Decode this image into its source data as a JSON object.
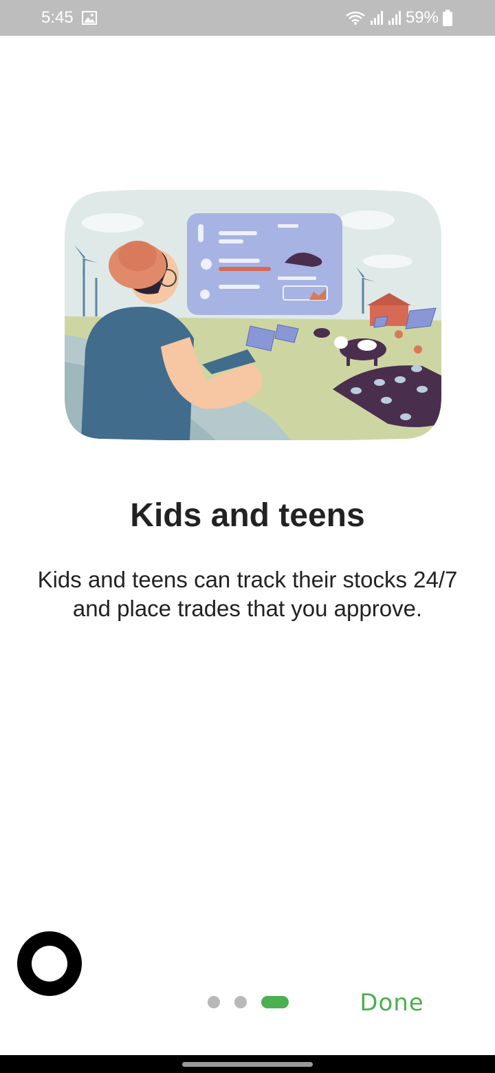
{
  "status_bar": {
    "time": "5:45",
    "battery_percent": "59%",
    "icons": [
      "image-icon",
      "wifi-icon",
      "signal-icon",
      "signal-icon",
      "battery-icon"
    ]
  },
  "onboarding": {
    "title": "Kids and teens",
    "description": "Kids and teens can track their stocks 24/7 and place trades that you approve.",
    "pager": {
      "total": 3,
      "current": 3
    },
    "done_label": "Done"
  },
  "colors": {
    "accent": "#4caf50",
    "status_bar": "#bdbdbd",
    "inactive_dot": "#b8b8b8"
  }
}
